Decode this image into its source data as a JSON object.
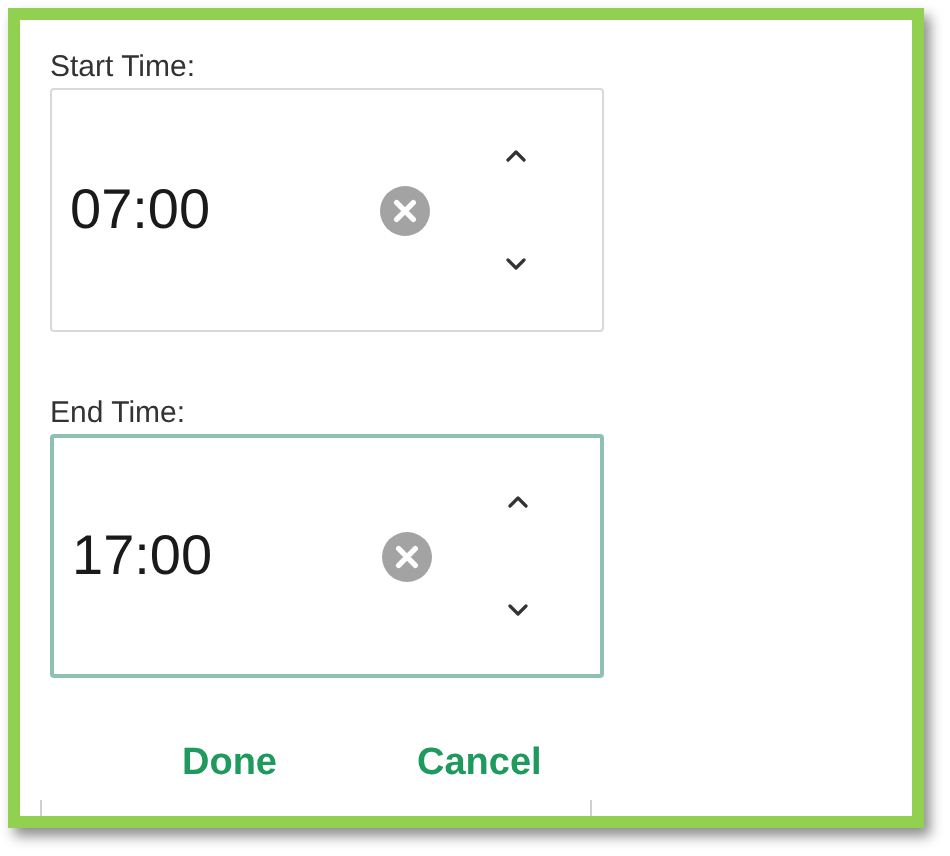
{
  "fields": [
    {
      "label": "Start Time:",
      "value": "07:00",
      "focused": false
    },
    {
      "label": "End Time:",
      "value": "17:00",
      "focused": true
    }
  ],
  "buttons": [
    "Done",
    "Cancel"
  ]
}
